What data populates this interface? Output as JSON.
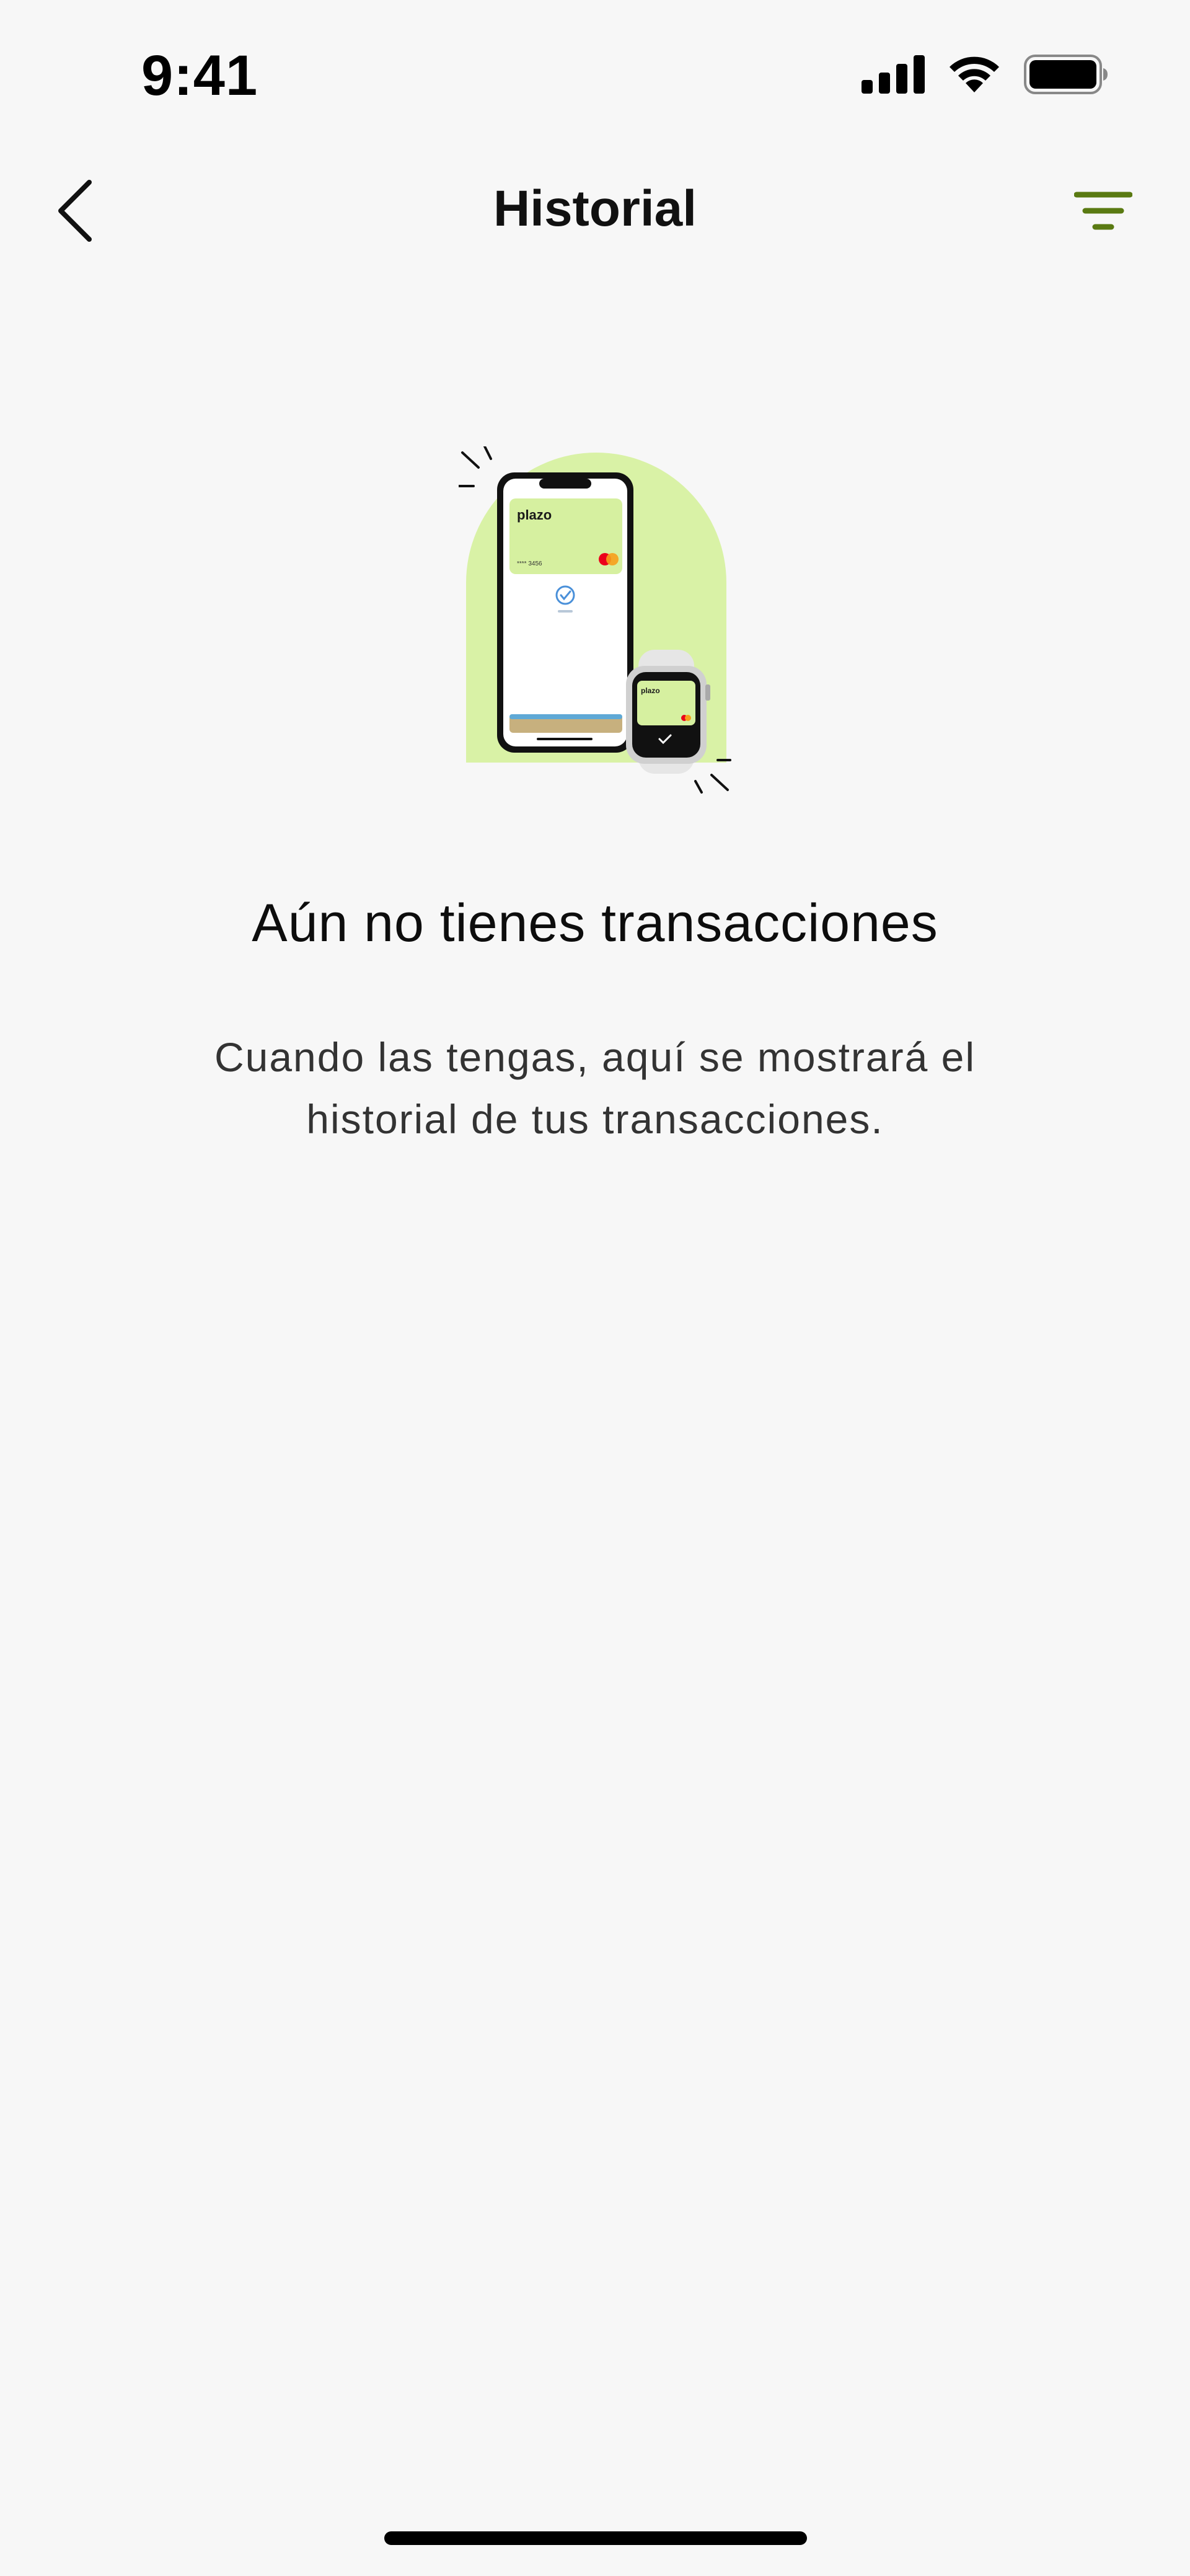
{
  "status_bar": {
    "time": "9:41",
    "icons": [
      "signal-icon",
      "wifi-icon",
      "battery-icon"
    ]
  },
  "nav": {
    "title": "Historial",
    "back_icon": "chevron-left-icon",
    "filter_icon": "filter-icon",
    "accent_color": "#5a7a12"
  },
  "illustration": {
    "brand": "plazo",
    "card_number": "**** 3456",
    "background_color": "#d9f2a6"
  },
  "empty_state": {
    "title": "Aún no tienes transacciones",
    "description": "Cuando las tengas, aquí se mostrará el historial de tus transacciones."
  }
}
